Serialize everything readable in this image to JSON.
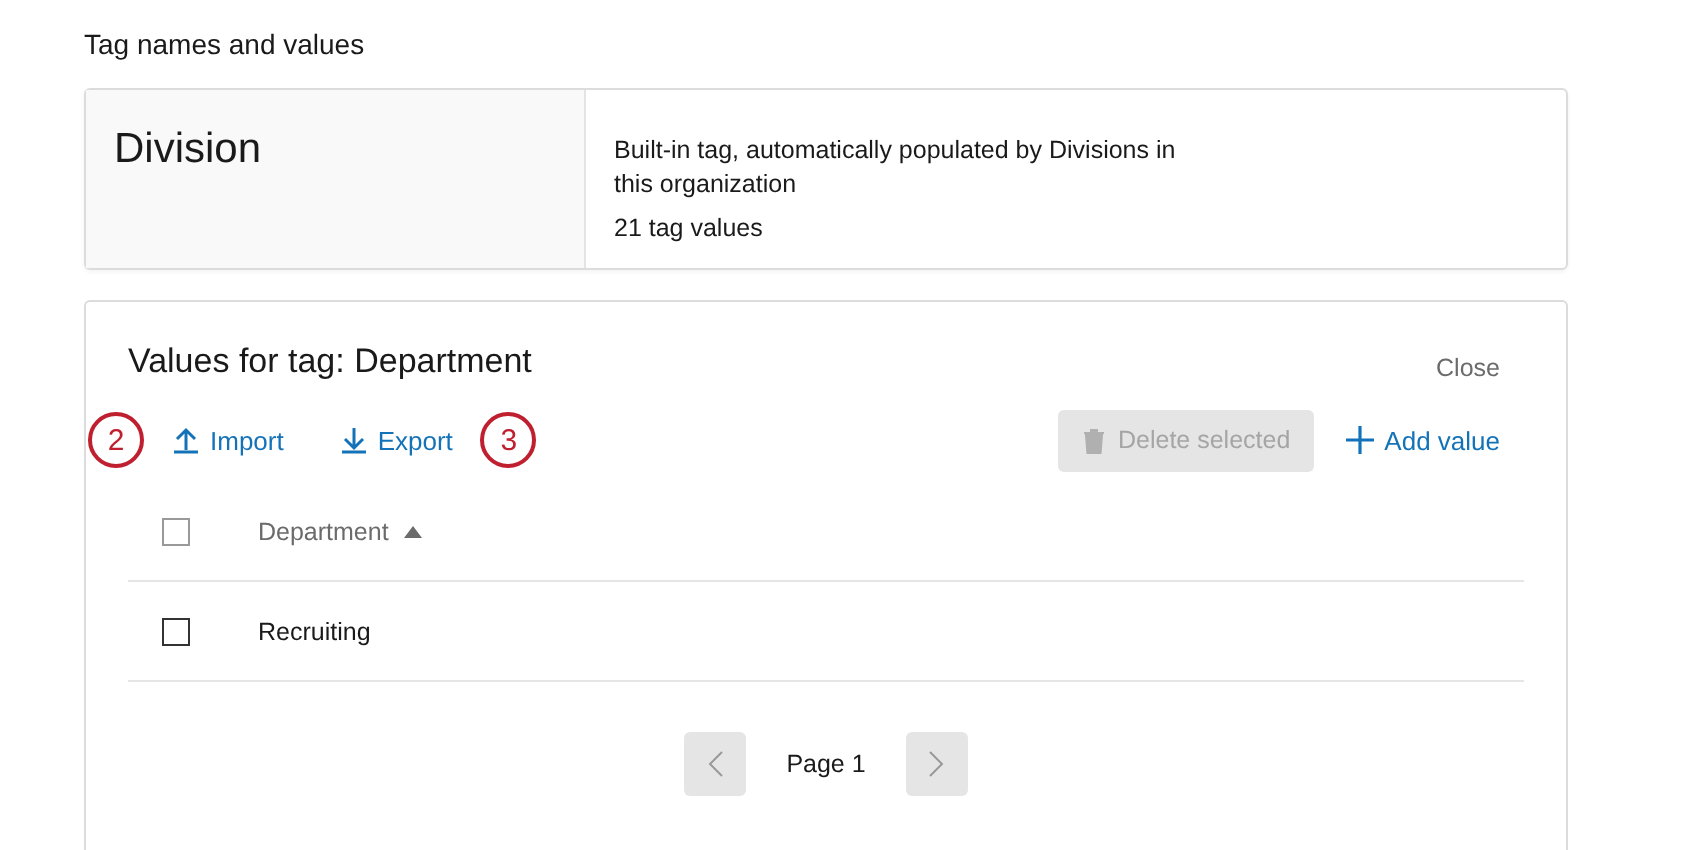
{
  "heading": "Tag names and values",
  "tag_card": {
    "name": "Division",
    "description": "Built-in tag, automatically populated by Divisions in this organization",
    "count": "21 tag values"
  },
  "values_panel": {
    "title": "Values for tag: Department",
    "close": "Close",
    "toolbar": [
      {
        "kind": "callout",
        "label": "2"
      },
      {
        "kind": "import",
        "label": "Import"
      },
      {
        "kind": "export",
        "label": "Export"
      },
      {
        "kind": "callout",
        "label": "3"
      }
    ],
    "delete_button": {
      "label": "Delete selected",
      "disabled": true
    },
    "add_button": {
      "label": "Add value"
    },
    "table": {
      "select_all_checked": false,
      "column": "Department",
      "sort_ascending": true,
      "rows": [
        {
          "value": "Recruiting",
          "checked": false
        }
      ]
    },
    "pager": {
      "label": "Page 1",
      "prev_disabled": true,
      "next_disabled": true
    }
  }
}
